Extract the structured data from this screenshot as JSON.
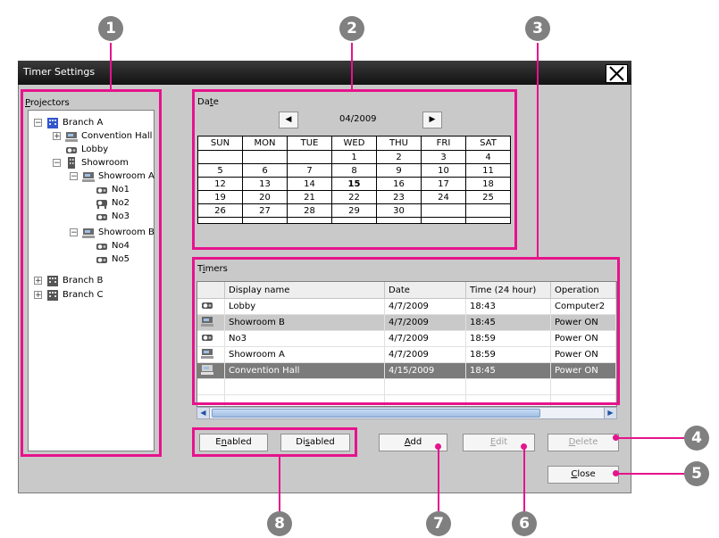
{
  "window": {
    "title": "Timer Settings",
    "close_glyph": "X"
  },
  "projectors": {
    "label_first": "P",
    "label_rest": "rojectors",
    "tree": [
      {
        "label": "Branch A",
        "expander": "−"
      },
      {
        "label": "Convention Hall",
        "expander": "+"
      },
      {
        "label": "Lobby"
      },
      {
        "label": "Showroom",
        "expander": "−"
      },
      {
        "label": "Showroom A",
        "expander": "−"
      },
      {
        "label": "No1"
      },
      {
        "label": "No2"
      },
      {
        "label": "No3"
      },
      {
        "label": "Showroom B",
        "expander": "−"
      },
      {
        "label": "No4"
      },
      {
        "label": "No5"
      },
      {
        "label": "Branch B",
        "expander": "+"
      },
      {
        "label": "Branch C",
        "expander": "+"
      }
    ]
  },
  "date": {
    "label_a": "Da",
    "label_u": "t",
    "label_b": "e",
    "prev": "◀",
    "next": "▶",
    "month": "04/2009",
    "weekdays": [
      "SUN",
      "MON",
      "TUE",
      "WED",
      "THU",
      "FRI",
      "SAT"
    ],
    "weeks": [
      [
        "",
        "",
        "",
        "1",
        "2",
        "3",
        "4"
      ],
      [
        "5",
        "6",
        "7",
        "8",
        "9",
        "10",
        "11"
      ],
      [
        "12",
        "13",
        "14",
        "15",
        "16",
        "17",
        "18"
      ],
      [
        "19",
        "20",
        "21",
        "22",
        "23",
        "24",
        "25"
      ],
      [
        "26",
        "27",
        "28",
        "29",
        "30",
        "",
        ""
      ],
      [
        "",
        "",
        "",
        "",
        "",
        "",
        ""
      ]
    ]
  },
  "timers": {
    "label_a": "T",
    "label_u": "i",
    "label_b": "mers",
    "columns": [
      "Display name",
      "Date",
      "Time (24 hour)",
      "Operation"
    ],
    "rows": [
      {
        "name": "Lobby",
        "date": "4/7/2009",
        "time": "18:43",
        "op": "Computer2",
        "icon": "projector-icon"
      },
      {
        "name": "Showroom B",
        "date": "4/7/2009",
        "time": "18:45",
        "op": "Power ON",
        "icon": "group-icon"
      },
      {
        "name": "No3",
        "date": "4/7/2009",
        "time": "18:59",
        "op": "Power ON",
        "icon": "projector-icon"
      },
      {
        "name": "Showroom A",
        "date": "4/7/2009",
        "time": "18:59",
        "op": "Power ON",
        "icon": "group-icon"
      },
      {
        "name": "Convention Hall",
        "date": "4/15/2009",
        "time": "18:45",
        "op": "Power ON",
        "icon": "group-icon"
      }
    ]
  },
  "buttons": {
    "enabled_a": "E",
    "enabled_u": "n",
    "enabled_b": "abled",
    "disabled_a": "Di",
    "disabled_u": "s",
    "disabled_b": "abled",
    "add_u": "A",
    "add_b": "dd",
    "edit_u": "E",
    "edit_b": "dit",
    "delete_u": "D",
    "delete_b": "elete",
    "close_u": "C",
    "close_b": "lose"
  },
  "callouts": [
    "1",
    "2",
    "3",
    "4",
    "5",
    "6",
    "7",
    "8"
  ],
  "colors": {
    "highlight": "#e6138c",
    "callout": "#808080"
  }
}
